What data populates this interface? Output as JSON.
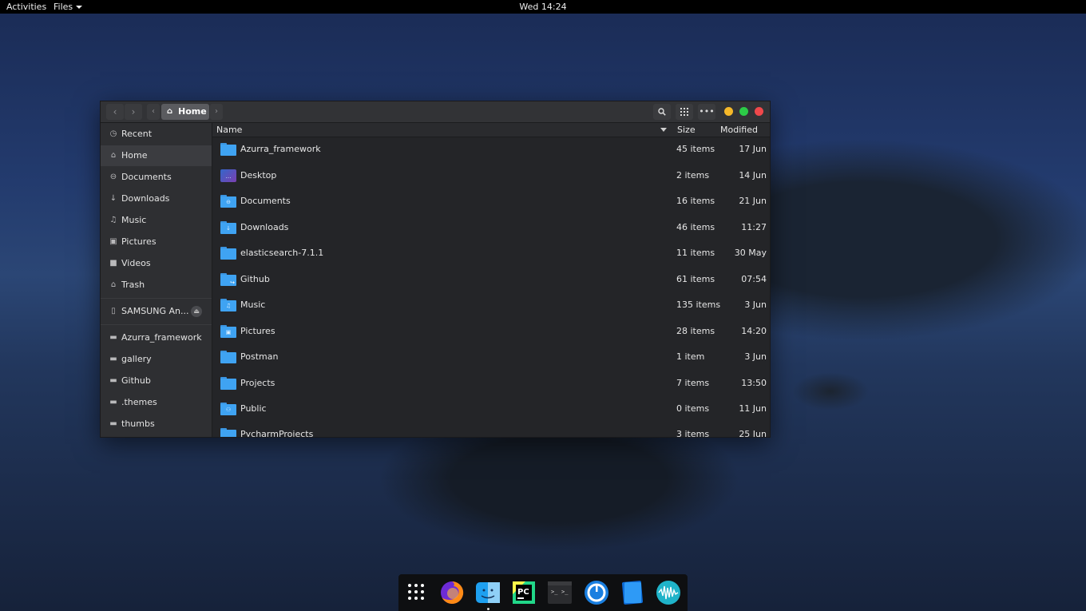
{
  "topbar": {
    "activities": "Activities",
    "app_menu": "Files",
    "clock": "Wed 14:24"
  },
  "window": {
    "path_home": "Home",
    "window_controls": {
      "minimize": "#f5b829",
      "maximize": "#2ccb47",
      "close": "#f0484b"
    }
  },
  "sidebar": {
    "places": [
      {
        "label": "Recent",
        "icon": "clock-icon"
      },
      {
        "label": "Home",
        "icon": "home-icon",
        "active": true
      },
      {
        "label": "Documents",
        "icon": "document-icon"
      },
      {
        "label": "Downloads",
        "icon": "download-icon"
      },
      {
        "label": "Music",
        "icon": "music-icon"
      },
      {
        "label": "Pictures",
        "icon": "picture-icon"
      },
      {
        "label": "Videos",
        "icon": "video-icon"
      },
      {
        "label": "Trash",
        "icon": "trash-icon"
      }
    ],
    "device": {
      "label": "SAMSUNG An...",
      "icon": "phone-icon"
    },
    "bookmarks": [
      {
        "label": "Azurra_framework"
      },
      {
        "label": "gallery"
      },
      {
        "label": "Github"
      },
      {
        "label": ".themes"
      },
      {
        "label": "thumbs"
      }
    ]
  },
  "list": {
    "columns": {
      "name": "Name",
      "size": "Size",
      "modified": "Modified"
    },
    "rows": [
      {
        "name": "Azurra_framework",
        "size": "45 items",
        "modified": "17 Jun"
      },
      {
        "name": "Desktop",
        "size": "2 items",
        "modified": "14 Jun"
      },
      {
        "name": "Documents",
        "size": "16 items",
        "modified": "21 Jun"
      },
      {
        "name": "Downloads",
        "size": "46 items",
        "modified": "11:27"
      },
      {
        "name": "elasticsearch-7.1.1",
        "size": "11 items",
        "modified": "30 May"
      },
      {
        "name": "Github",
        "size": "61 items",
        "modified": "07:54"
      },
      {
        "name": "Music",
        "size": "135 items",
        "modified": "3 Jun"
      },
      {
        "name": "Pictures",
        "size": "28 items",
        "modified": "14:20"
      },
      {
        "name": "Postman",
        "size": "1 item",
        "modified": "3 Jun"
      },
      {
        "name": "Projects",
        "size": "7 items",
        "modified": "13:50"
      },
      {
        "name": "Public",
        "size": "0 items",
        "modified": "11 Jun"
      },
      {
        "name": "PycharmProjects",
        "size": "3 items",
        "modified": "25 Jun"
      }
    ]
  },
  "dock": {
    "items": [
      "show-apps-icon",
      "firefox-icon",
      "files-finder-icon",
      "pycharm-icon",
      "terminal-icon",
      "timer-app-icon",
      "notes-app-icon",
      "audio-waveform-icon"
    ]
  }
}
